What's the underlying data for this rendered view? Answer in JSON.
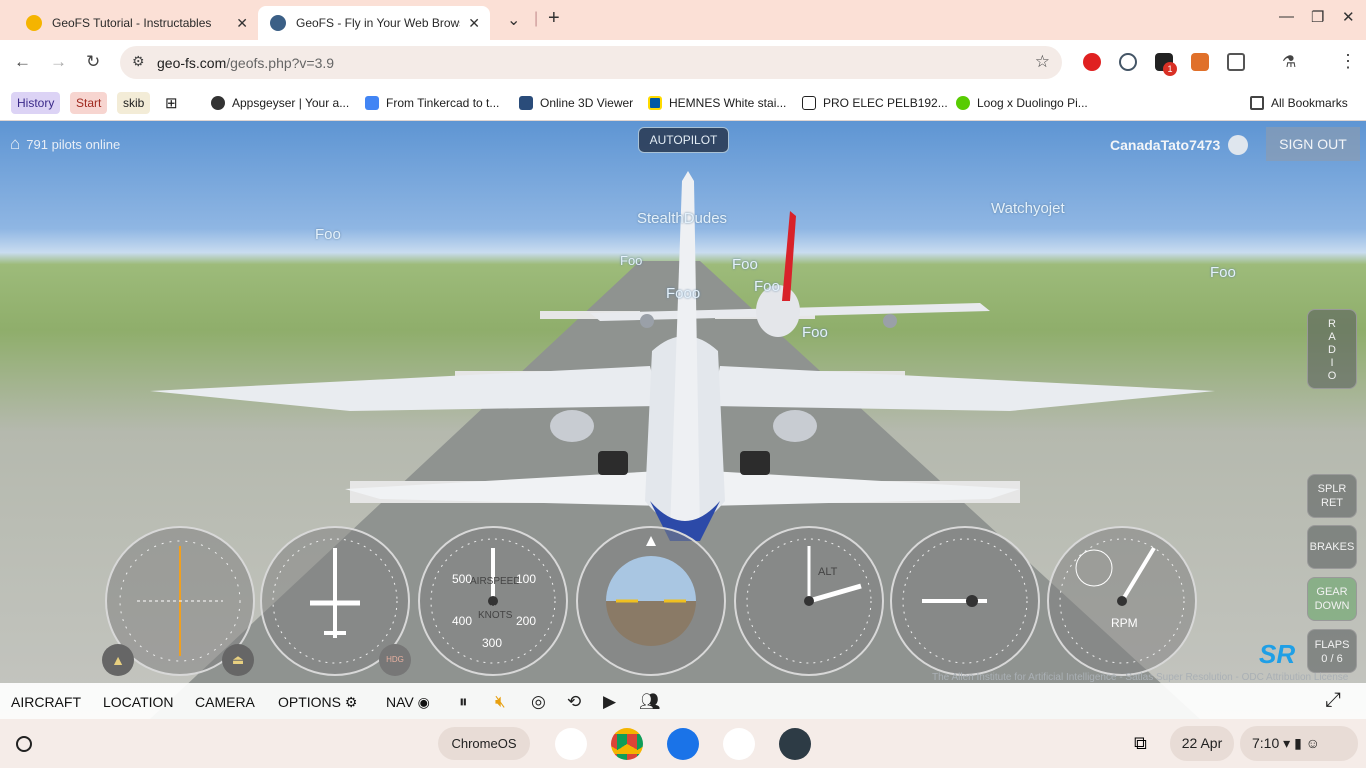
{
  "tabs": [
    {
      "title": "GeoFS Tutorial - Instructables",
      "icon": "instructables-favicon-icon",
      "active": false
    },
    {
      "title": "GeoFS - Fly in Your Web Browser",
      "icon": "geofs-favicon-icon",
      "active": true
    }
  ],
  "omnibox": {
    "url_host": "geo-fs.com",
    "url_path": "/geofs.php?v=3.9"
  },
  "extensions": {
    "badge_count": "1"
  },
  "bookmarks": [
    {
      "label": "History",
      "icon": ""
    },
    {
      "label": "Start",
      "icon": ""
    },
    {
      "label": "skib",
      "icon": ""
    },
    {
      "label": "Appsgeyser | Your a...",
      "icon": "appsgeyser-icon"
    },
    {
      "label": "From Tinkercad to t...",
      "icon": "google-docs-icon"
    },
    {
      "label": "Online 3D Viewer",
      "icon": "3d-viewer-icon"
    },
    {
      "label": "HEMNES White stai...",
      "icon": "ikea-icon"
    },
    {
      "label": "PRO ELEC PELB192...",
      "icon": "amazon-icon"
    },
    {
      "label": "Loog x Duolingo Pi...",
      "icon": "duolingo-icon"
    }
  ],
  "all_bookmarks": "All Bookmarks",
  "game": {
    "pilots_online": "791 pilots online",
    "autopilot": "AUTOPILOT",
    "username": "CanadaTato7473",
    "sign_out": "SIGN OUT",
    "player_labels": [
      "Foo",
      "StealthDudes",
      "Watchyojet",
      "Foo",
      "Foo",
      "Fooo",
      "Foo",
      "Foo",
      "Foo"
    ],
    "side_buttons": {
      "radio": [
        "R",
        "A",
        "D",
        "I",
        "O"
      ],
      "spoilers": [
        "SPLR",
        "RET"
      ],
      "brakes": "BRAKES",
      "gear": [
        "GEAR",
        "DOWN"
      ],
      "flaps": [
        "FLAPS",
        "0 / 6"
      ]
    },
    "gauges": {
      "airspeed_labels": [
        "AIRSPEED",
        "KNOTS"
      ],
      "airspeed_ticks": [
        "500",
        "100",
        "400",
        "200",
        "300"
      ],
      "altimeter_label": "ALT",
      "rpm_label": "RPM",
      "hdg_label": "HDG"
    },
    "sr_logo": "SR",
    "attribution": "The Allen Institute for Artificial Intelligence - Satlas Super Resolution - ODC Attribution License",
    "menu": [
      "AIRCRAFT",
      "LOCATION",
      "CAMERA",
      "OPTIONS",
      "NAV"
    ]
  },
  "shelf": {
    "chromeos": "ChromeOS",
    "date": "22 Apr",
    "time": "7:10"
  },
  "colors": {
    "tabstrip": "#fbe0d6",
    "sky": "#5e95d3",
    "accent_blue": "#1f9fe6",
    "gear_green": "#78aa78"
  }
}
